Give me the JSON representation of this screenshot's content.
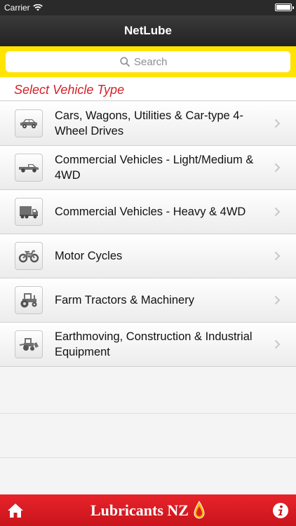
{
  "status_bar": {
    "carrier": "Carrier"
  },
  "navbar": {
    "title": "NetLube"
  },
  "search": {
    "placeholder": "Search"
  },
  "section": {
    "header": "Select Vehicle Type"
  },
  "vehicle_types": [
    {
      "label": "Cars, Wagons, Utilities & Car-type 4-Wheel Drives",
      "icon": "car-icon"
    },
    {
      "label": "Commercial Vehicles - Light/Medium & 4WD",
      "icon": "pickup-truck-icon"
    },
    {
      "label": "Commercial Vehicles - Heavy & 4WD",
      "icon": "heavy-truck-icon"
    },
    {
      "label": "Motor Cycles",
      "icon": "motorcycle-icon"
    },
    {
      "label": "Farm Tractors & Machinery",
      "icon": "tractor-icon"
    },
    {
      "label": "Earthmoving, Construction & Industrial Equipment",
      "icon": "loader-icon"
    }
  ],
  "footer": {
    "brand": "Lubricants NZ"
  },
  "colors": {
    "brand_red": "#d61f26",
    "search_yellow": "#ffe400",
    "navbar_dark": "#2a2a2a"
  }
}
